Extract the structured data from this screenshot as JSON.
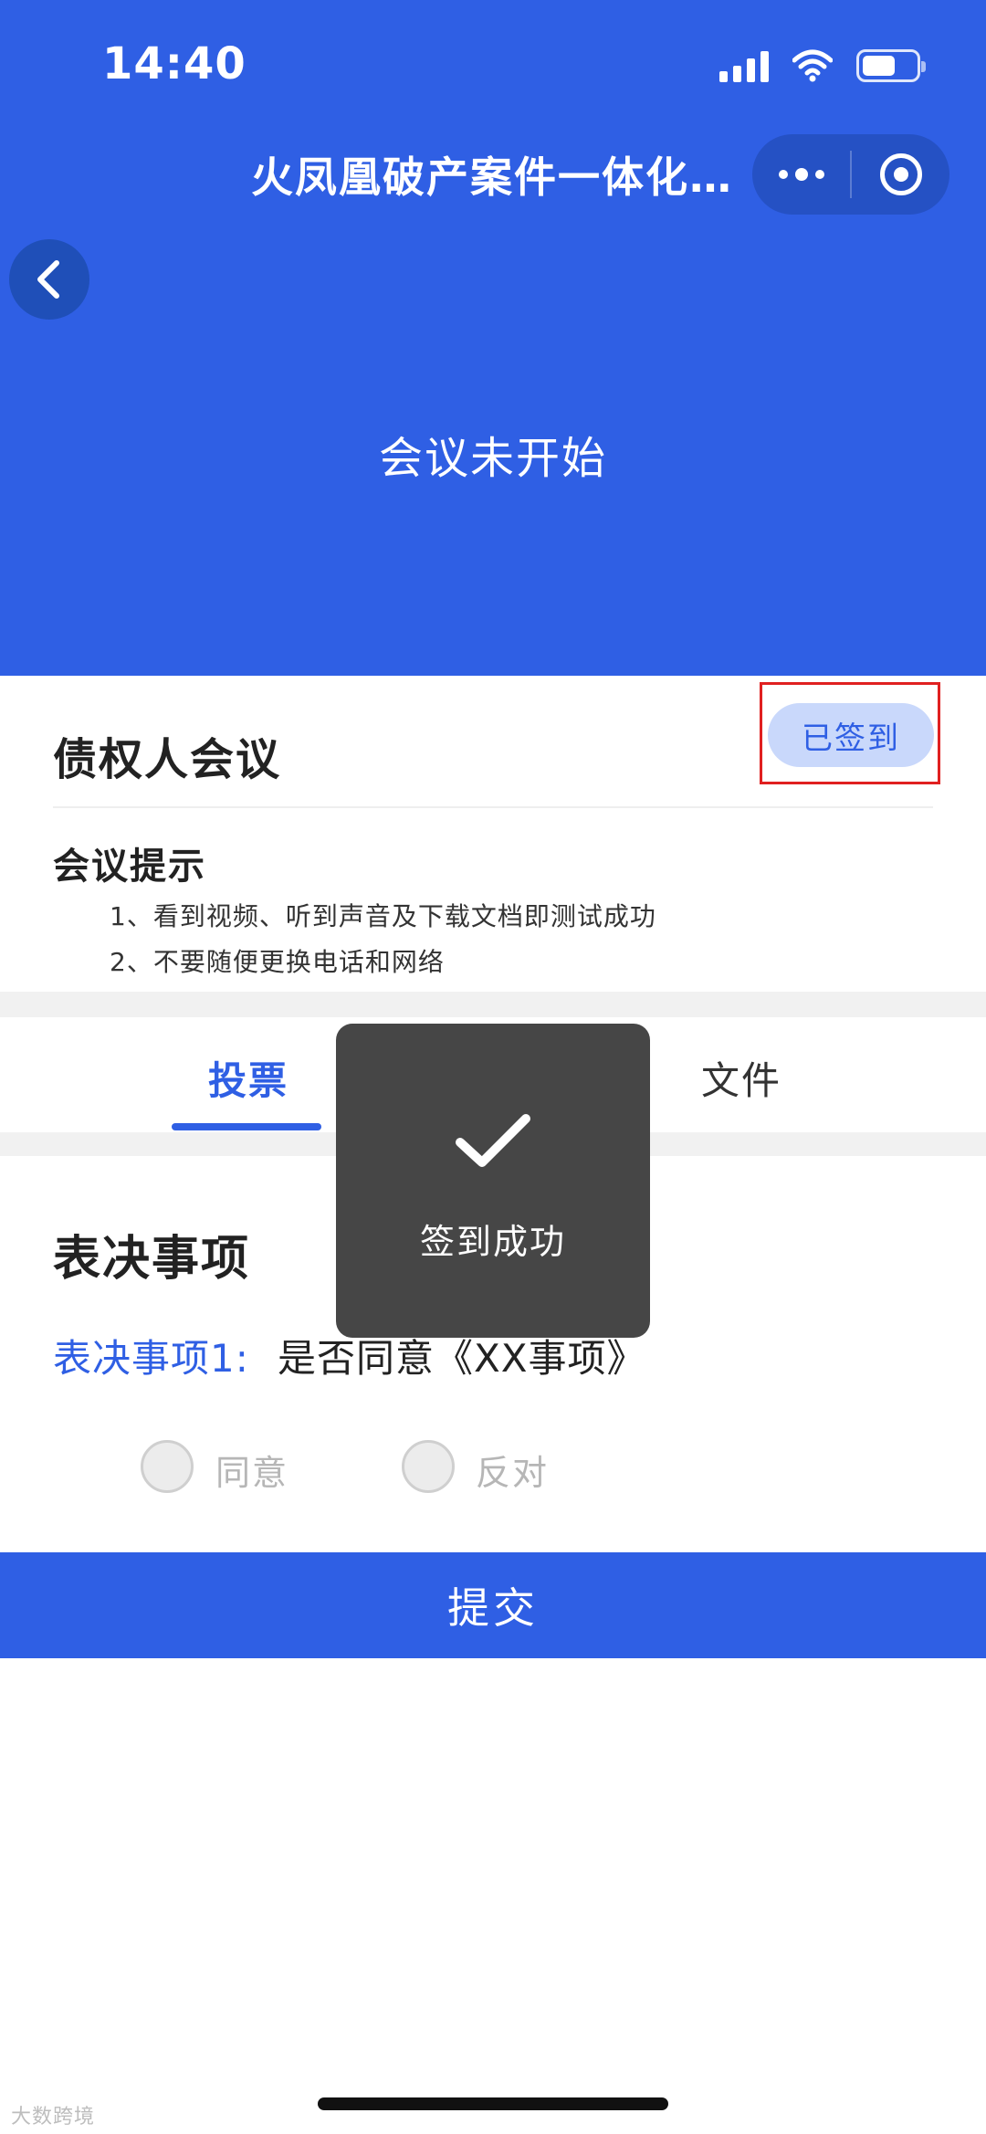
{
  "status_bar": {
    "time": "14:40"
  },
  "nav": {
    "title": "火凤凰破产案件一体化…"
  },
  "video": {
    "message": "会议未开始"
  },
  "meeting": {
    "title": "债权人会议",
    "signed_label": "已签到",
    "tips_title": "会议提示",
    "tips": [
      "1、看到视频、听到声音及下载文档即测试成功",
      "2、不要随便更换电话和网络"
    ]
  },
  "tabs": [
    {
      "label": "投票",
      "active": true
    },
    {
      "label": "文件",
      "active": false
    }
  ],
  "voting": {
    "heading": "表决事项",
    "item_label": "表决事项1:",
    "item_text": "是否同意《XX事项》",
    "options": [
      "同意",
      "反对"
    ],
    "submit_label": "提交"
  },
  "toast": {
    "message": "签到成功"
  },
  "watermark": "大数跨境",
  "colors": {
    "primary": "#2f5fe4",
    "signed_bg": "#c9d8fb",
    "highlight_border": "#e02020",
    "toast_bg": "#3c3c3c"
  }
}
